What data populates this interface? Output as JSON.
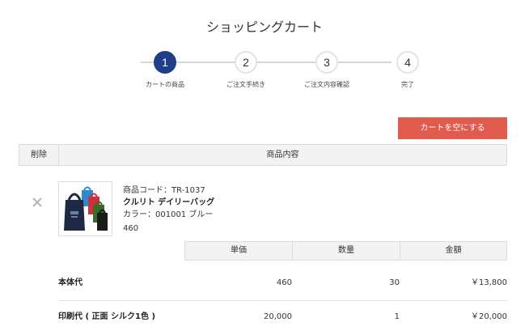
{
  "page": {
    "title": "ショッピングカート"
  },
  "steps": [
    {
      "number": "1",
      "label": "カートの商品",
      "active": true
    },
    {
      "number": "2",
      "label": "ご注文手続き",
      "active": false
    },
    {
      "number": "3",
      "label": "ご注文内容確認",
      "active": false
    },
    {
      "number": "4",
      "label": "完了",
      "active": false
    }
  ],
  "actions": {
    "empty_cart_label": "カートを空にする"
  },
  "cart_table": {
    "col_delete": "削除",
    "col_content": "商品内容"
  },
  "product": {
    "code": "商品コード：TR-1037",
    "name": "クルリト デイリーバッグ",
    "color": "カラー：001001 ブルー",
    "price": "460",
    "thumbnail_icon": "tote-bag-icon"
  },
  "price_table": {
    "headers": [
      "単価",
      "数量",
      "金額"
    ],
    "rows": [
      {
        "label": "本体代",
        "unit_price": "460",
        "quantity": "30",
        "amount": "￥13,800"
      },
      {
        "label": "印刷代 ( 正面 シルク1色 )",
        "unit_price": "20,000",
        "quantity": "1",
        "amount": "￥20,000"
      }
    ]
  },
  "colors": {
    "step_active": "#1f3e88",
    "empty_cart_button": "#e05a4e",
    "bag_colors": [
      "#1e2a45",
      "#2a8ccf",
      "#d32f3a",
      "#3a6b2e",
      "#1b1b1b"
    ]
  }
}
